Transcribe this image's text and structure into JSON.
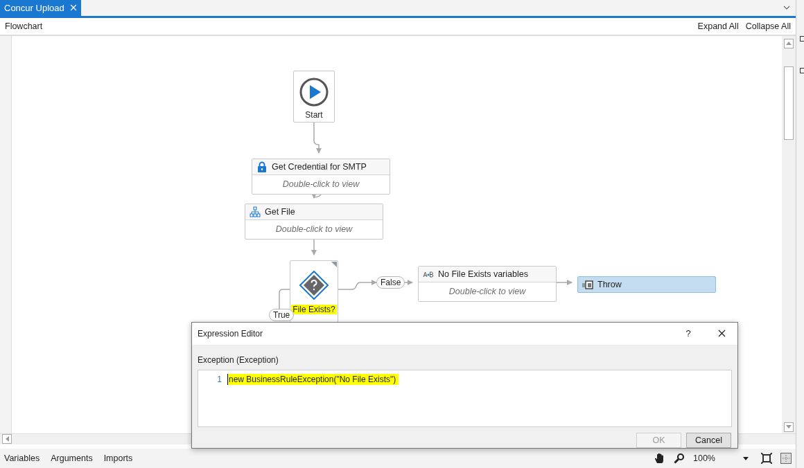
{
  "tabs": [
    {
      "label": "Concur Upload",
      "selected": true
    }
  ],
  "header": {
    "title": "Flowchart",
    "actions": [
      "Expand All",
      "Collapse All"
    ]
  },
  "flowchart": {
    "nodes": [
      {
        "kind": "start",
        "label": "Start"
      },
      {
        "kind": "credential",
        "title": "Get Credential for SMTP",
        "hint": "Double-click to view",
        "selected": false
      },
      {
        "kind": "sequence",
        "title": "Get File",
        "hint": "Double-click to view",
        "selected": false
      },
      {
        "kind": "decision",
        "label": "File Exists?",
        "highlighted": true
      },
      {
        "kind": "assign",
        "title": "No File Exists variables",
        "hint": "Double-click to view",
        "selected": false
      },
      {
        "kind": "throw",
        "title": "Throw",
        "selected": true
      }
    ],
    "branches": [
      {
        "label": "True"
      },
      {
        "label": "False"
      }
    ]
  },
  "dialog": {
    "title": "Expression Editor",
    "help": "?",
    "field_label": "Exception (Exception)",
    "lines": [
      {
        "number": "1",
        "code": "new BusinessRuleException(\"No File Exists\")",
        "highlighted": true
      }
    ],
    "buttons": [
      {
        "label": "OK",
        "disabled": true
      },
      {
        "label": "Cancel",
        "disabled": false
      }
    ]
  },
  "status_bar": {
    "tabs": [
      "Variables",
      "Arguments",
      "Imports"
    ],
    "zoom": "100%"
  }
}
